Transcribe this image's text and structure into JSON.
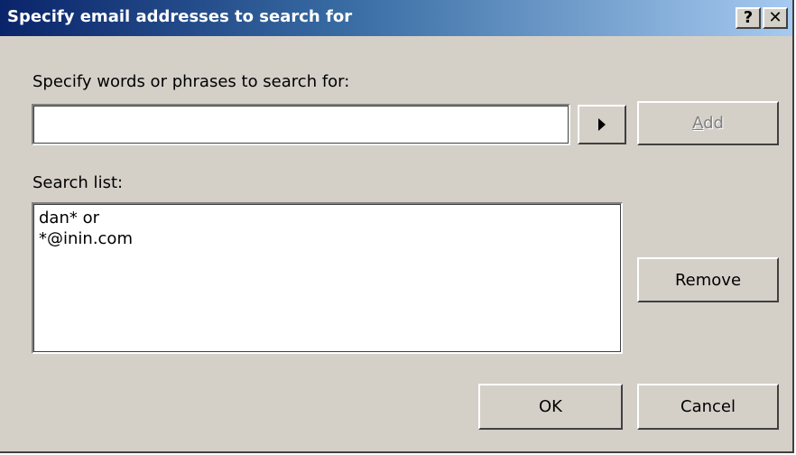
{
  "dialog": {
    "title": "Specify email addresses to search for",
    "help_glyph": "?",
    "close_glyph": "✕"
  },
  "phrase": {
    "label": "Specify words or phrases to search for:",
    "value": "",
    "arrow_icon": "triangle-right-icon",
    "add_accel": "A",
    "add_rest": "dd"
  },
  "search_list": {
    "label": "Search list:",
    "items": [
      "dan* or",
      "*@inin.com"
    ]
  },
  "buttons": {
    "remove": "Remove",
    "ok": "OK",
    "cancel": "Cancel"
  },
  "colors": {
    "face": "#d4d0c8",
    "title_start": "#0a246a",
    "title_end": "#a6caf0"
  }
}
